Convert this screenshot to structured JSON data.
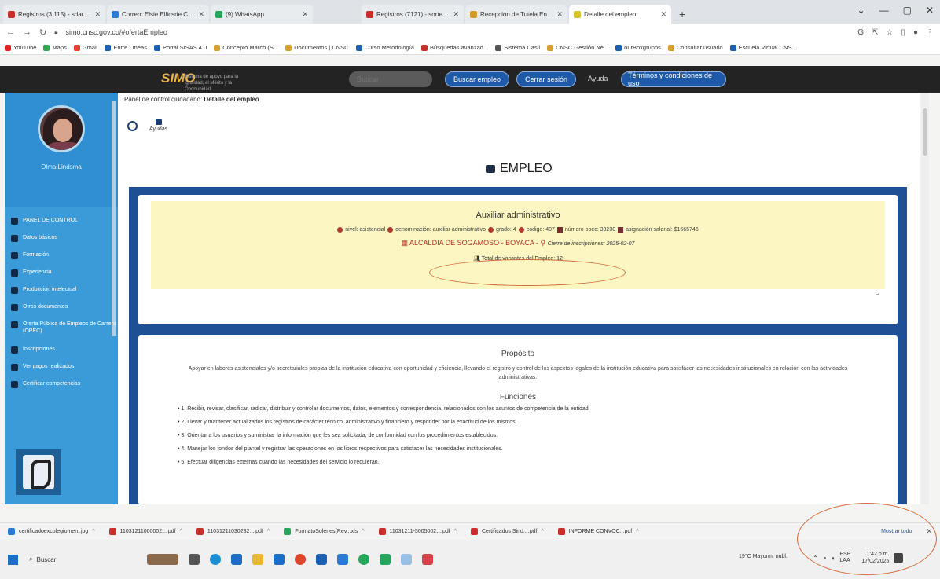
{
  "browser": {
    "tabs": [
      {
        "label": "Registros (3.115) - sdardiad@u",
        "color": "#c8302b"
      },
      {
        "label": "Correo: Elsie Ellicsrie Caqueza",
        "color": "#2a7ad6"
      },
      {
        "label": "(9) WhatsApp",
        "color": "#26a65b"
      },
      {
        "label": "Registros (7121) - sorteadostud",
        "color": "#c8302b"
      },
      {
        "label": "Recepción de Tutela En línea",
        "color": "#d69b2a"
      },
      {
        "label": "Detalle del empleo",
        "color": "#d6c42a"
      }
    ],
    "new_tab": "+",
    "window_controls": [
      "⌄",
      "—",
      "▢",
      "✕"
    ],
    "url": "simo.cnsc.gov.co/#ofertaEmpleo",
    "bookmarks": [
      "YouTube",
      "Maps",
      "Gmail",
      "Entre Líneas",
      "Portal SISAS 4.0",
      "Concepto Marco (S...",
      "Documentos | CNSC",
      "Curso Metodología",
      "Búsquedas avanzad...",
      "Sistema Casil",
      "CNSC Gestión Ne...",
      "ourBoxgrupos",
      "Consultar usuario",
      "Escuela Virtual CNS..."
    ]
  },
  "site_header": {
    "logo": "SIMO",
    "logo_sub": "Sistema de apoyo para la igualdad, el Mérito y la Oportunidad",
    "search_placeholder": "Buscar",
    "buttons": {
      "buscar_empleo": "Buscar empleo",
      "cerrar_sesion": "Cerrar sesión",
      "ayuda": "Ayuda",
      "terminos": "Términos y condiciones de uso"
    }
  },
  "sidebar": {
    "user_name": "Olma Lindsma",
    "items": [
      "PANEL DE CONTROL",
      "Datos básicos",
      "Formación",
      "Experiencia",
      "Producción intelectual",
      "Otros documentos",
      "Oferta Pública de Empleos de Carrera (OPEC)",
      "Inscripciones",
      "Ver pagos realizados",
      "Certificar competencias"
    ]
  },
  "main": {
    "breadcrumb_prefix": "Panel de control ciudadano:",
    "breadcrumb_current": "Detalle del empleo",
    "help_label": "Ayudas",
    "page_title": "EMPLEO",
    "job": {
      "title": "Auxiliar administrativo",
      "meta": [
        "nivel: asistencial",
        "denominación: auxiliar administrativo",
        "grado: 4",
        "código: 407",
        "número opec: 33230",
        "asignación salarial: $1665746"
      ],
      "entity": "ALCALDIA DE SOGAMOSO - BOYACA -",
      "deadline_label": "Cierre de inscripciones: 2025-02-07",
      "vacancies": "Total de vacantes del Empleo: 12"
    },
    "proposito_title": "Propósito",
    "proposito_text": "Apoyar en labores asistenciales y/o secretariales propias de la institución educativa con oportunidad y eficiencia, llevando el registro y control de los aspectos legales de la institución educativa para satisfacer las necesidades institucionales en relación con las actividades administrativas.",
    "funciones_title": "Funciones",
    "funciones": [
      "1. Recibir, revisar, clasificar, radicar, distribuir y controlar documentos, datos, elementos y correspondencia, relacionados con los asuntos de competencia de la entidad.",
      "2. Llevar y mantener actualizados los registros de carácter técnico, administrativo y financiero y responder por la exactitud de los mismos.",
      "3. Orientar a los usuarios y suministrar la información que les sea solicitada, de conformidad con los procedimientos establecidos.",
      "4. Manejar los fondos del plantel y registrar las operaciones en los libros respectivos para satisfacer las necesidades institucionales.",
      "5. Efectuar diligencias externas cuando las necesidades del servicio lo requieran."
    ]
  },
  "downloads": {
    "items": [
      "certificadoexcolegiomen..jpg",
      "11031211000002....pdf",
      "11031211030232....pdf",
      "FormatoSolenes(Rev...xls",
      "11031211-5005002....pdf",
      "Certificados Sind....pdf",
      "INFORME CONVOC...pdf"
    ],
    "show_all": "Mostrar todo",
    "close": "✕"
  },
  "taskbar": {
    "search_label": "Buscar",
    "weather": "19°C Mayorm. nubl.",
    "lang": "ESP LAA",
    "time": "1:42 p.m.",
    "date": "17/02/2025"
  }
}
